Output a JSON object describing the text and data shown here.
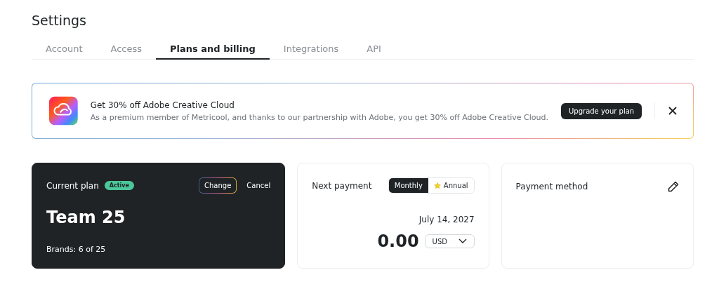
{
  "page": {
    "title": "Settings"
  },
  "tabs": [
    {
      "label": "Account",
      "selected": false
    },
    {
      "label": "Access",
      "selected": false
    },
    {
      "label": "Plans and billing",
      "selected": true
    },
    {
      "label": "Integrations",
      "selected": false
    },
    {
      "label": "API",
      "selected": false
    }
  ],
  "banner": {
    "title": "Get 30% off Adobe Creative Cloud",
    "message": "As a premium member of Metricool, and thanks to our partnership with Adobe, you get 30% off Adobe Creative Cloud.",
    "button": "Upgrade your plan"
  },
  "current_plan": {
    "label": "Current plan",
    "status": "Active",
    "change": "Change",
    "cancel": "Cancel",
    "plan": "Team 25",
    "brands": "Brands: 6 of 25"
  },
  "next_payment": {
    "label": "Next payment",
    "periods": [
      {
        "label": "Monthly",
        "selected": true,
        "starred": false
      },
      {
        "label": "Annual",
        "selected": false,
        "starred": true
      }
    ],
    "date": "July 14, 2027",
    "amount": "0.00",
    "currency": "USD"
  },
  "payment_method": {
    "label": "Payment method"
  }
}
